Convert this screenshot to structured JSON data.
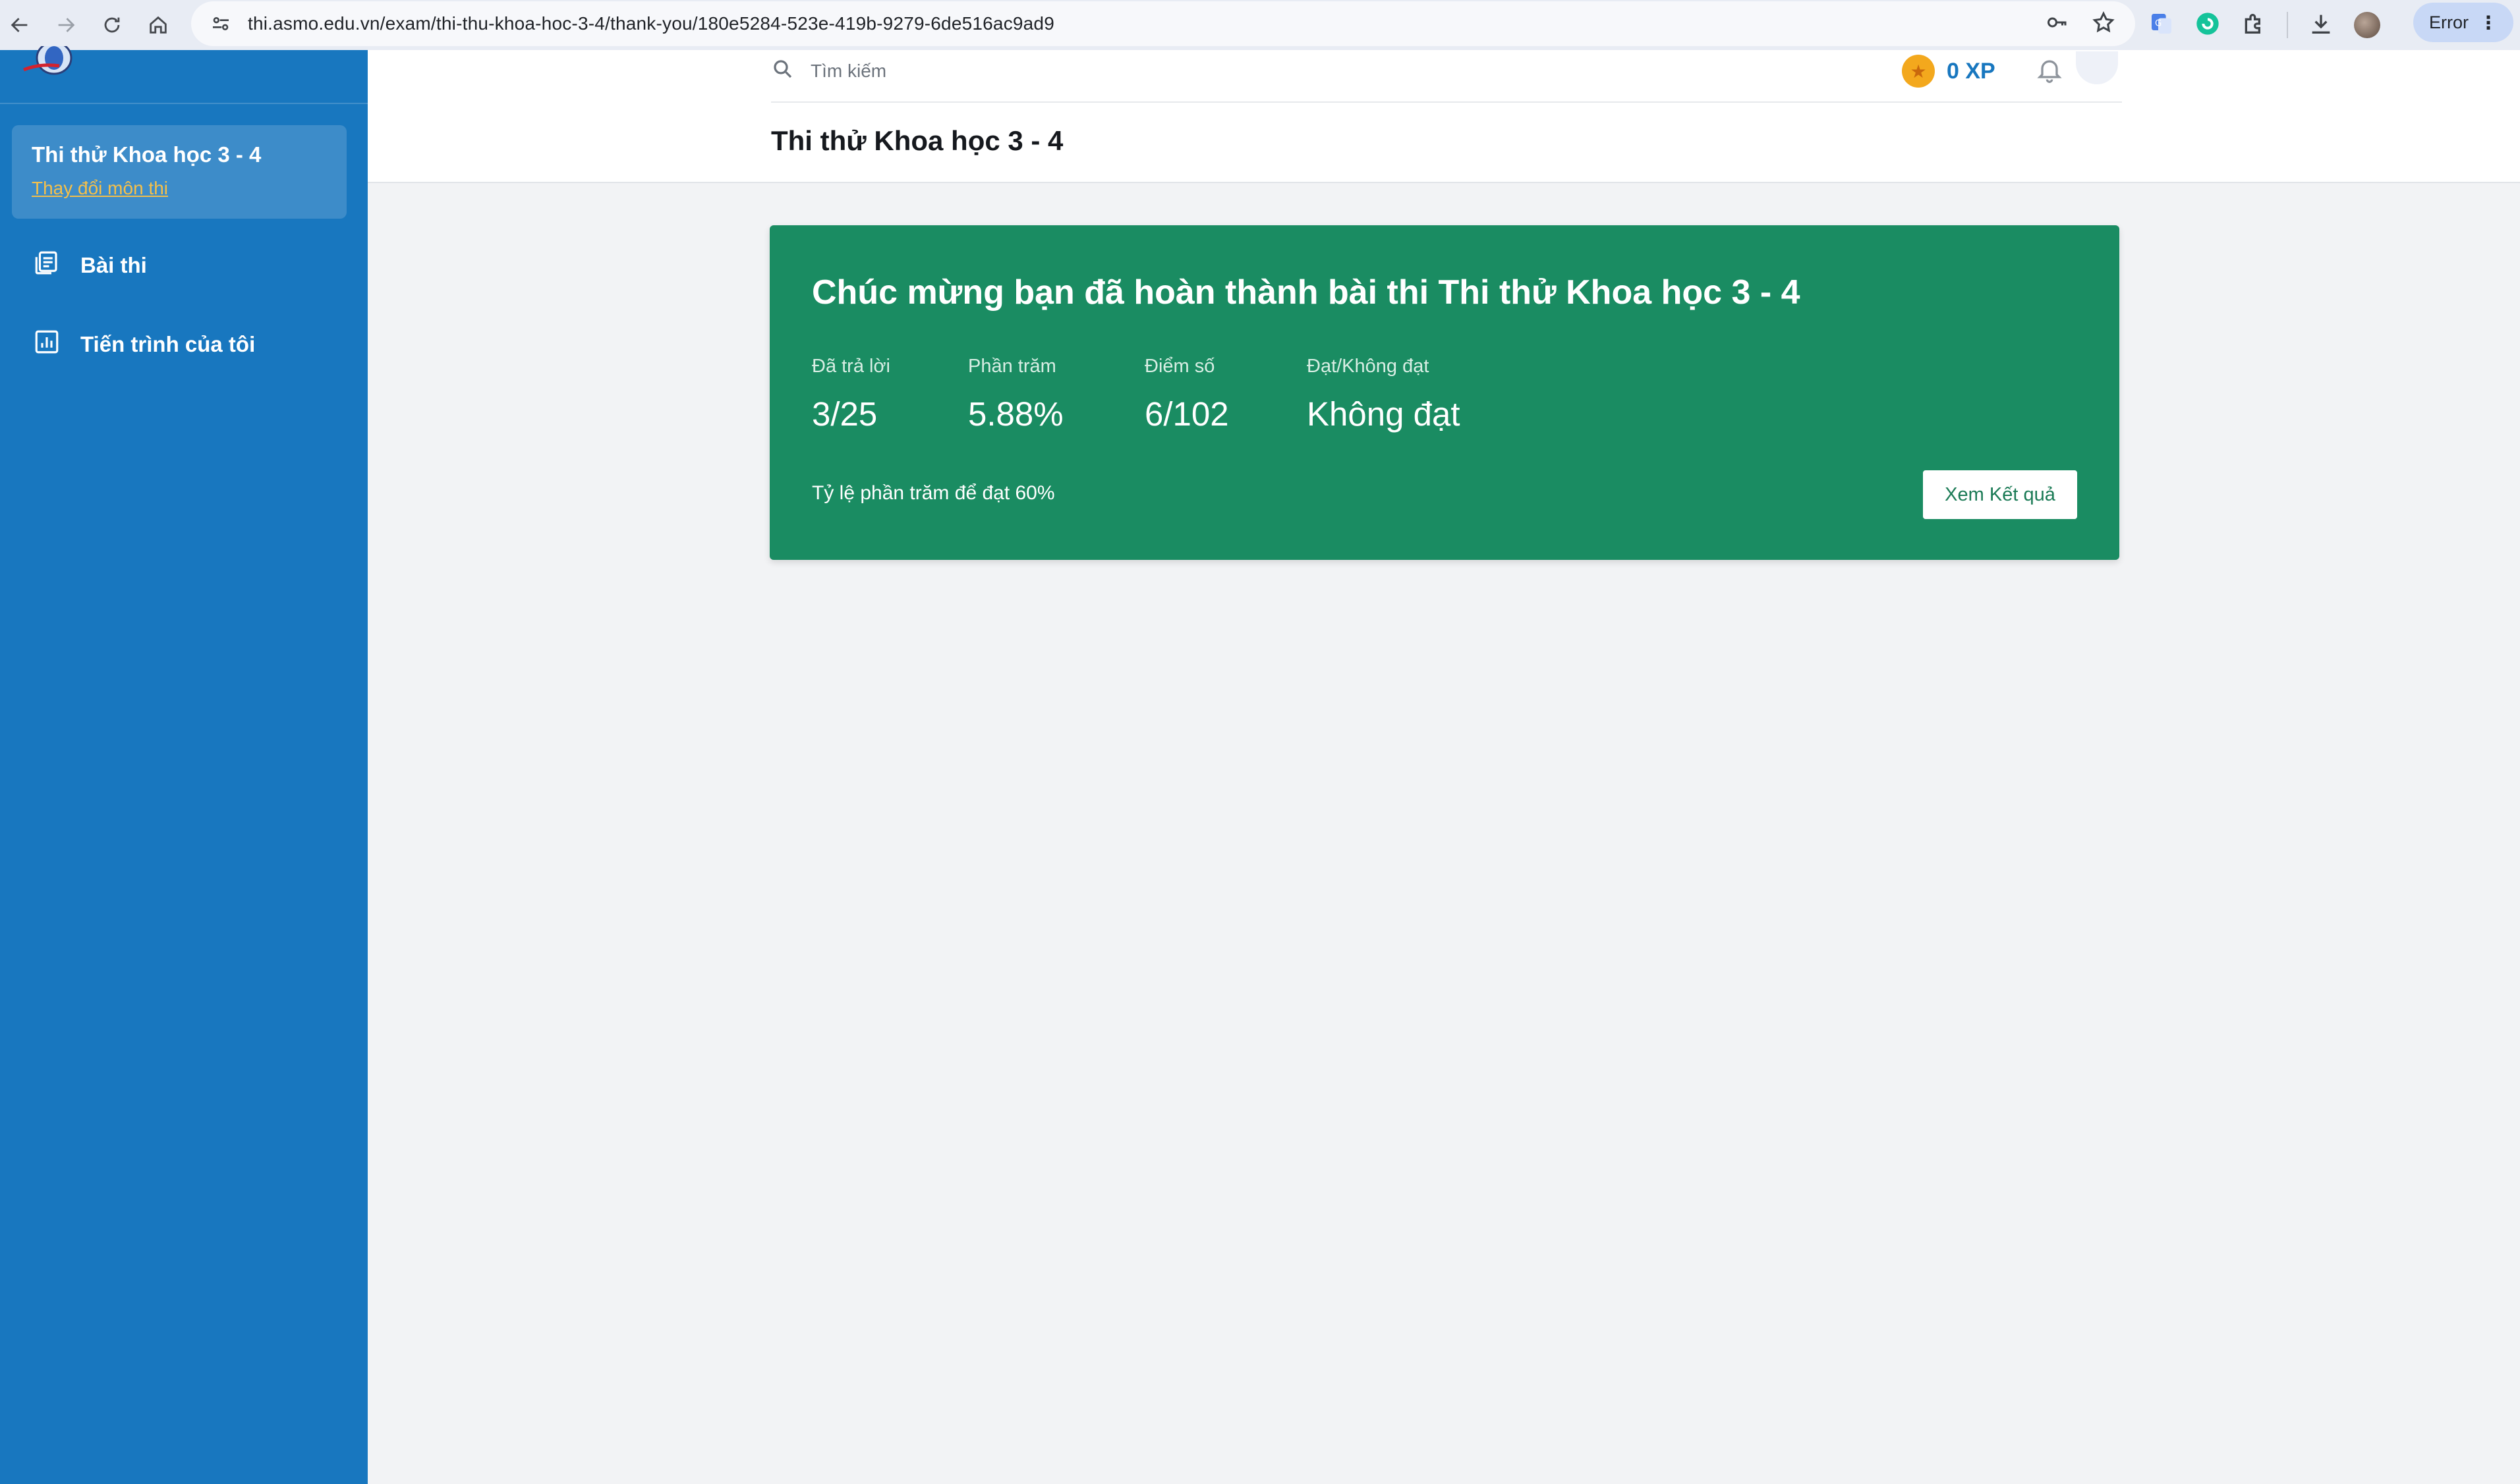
{
  "browser": {
    "url": "thi.asmo.edu.vn/exam/thi-thu-khoa-hoc-3-4/thank-you/180e5284-523e-419b-9279-6de516ac9ad9",
    "error_label": "Error"
  },
  "sidebar": {
    "exam_title": "Thi thử Khoa học 3 - 4",
    "change_exam": "Thay đổi môn thi",
    "items": [
      {
        "label": "Bài thi",
        "icon": "document-list-icon"
      },
      {
        "label": "Tiến trình của tôi",
        "icon": "bar-chart-icon"
      }
    ]
  },
  "header": {
    "search_placeholder": "Tìm kiếm",
    "xp": "0 XP",
    "page_title": "Thi thử Khoa học 3 - 4"
  },
  "result": {
    "heading": "Chúc mừng bạn đã hoàn thành bài thi Thi thử Khoa học 3 - 4",
    "stats": [
      {
        "label": "Đã trả lời",
        "value": "3/25"
      },
      {
        "label": "Phần trăm",
        "value": "5.88%"
      },
      {
        "label": "Điểm số",
        "value": "6/102"
      },
      {
        "label": "Đạt/Không đạt",
        "value": "Không đạt"
      }
    ],
    "pass_rate_text": "Tỷ lệ phần trăm để đạt 60%",
    "view_button": "Xem Kết quả"
  },
  "colors": {
    "sidebar": "#1877bf",
    "card": "#1a8c62",
    "link": "#f5c04a",
    "xp": "#1877bf"
  }
}
